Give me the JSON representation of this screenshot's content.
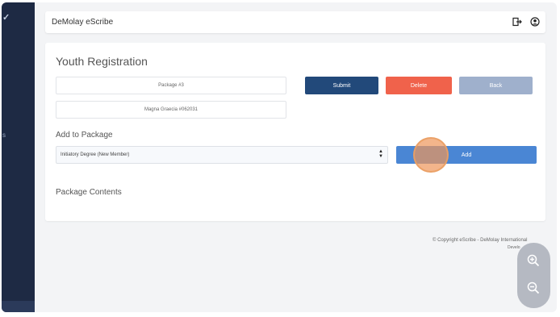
{
  "app": {
    "title": "DeMolay eScribe"
  },
  "page": {
    "title": "Youth Registration"
  },
  "fields": {
    "package": "Package #3",
    "chapter": "Magna Graecia #062031"
  },
  "actions": {
    "submit": "Submit",
    "delete": "Delete",
    "back": "Back"
  },
  "add_to_package": {
    "label": "Add to Package",
    "selected_option": "Initiatory Degree (New Member)",
    "add_label": "Add"
  },
  "package_contents": {
    "label": "Package Contents"
  },
  "footer": {
    "copyright": "© Copyright eScribe - DeMolay International",
    "sub": "Develo"
  },
  "colors": {
    "sidebar": "#1e2a44",
    "submit": "#22497a",
    "delete": "#f0624b",
    "back": "#9fb0cc",
    "add": "#4a86d4"
  },
  "icons": [
    "logout-icon",
    "user-circle-icon",
    "zoom-in-icon",
    "zoom-out-icon",
    "sort-arrows-icon"
  ]
}
